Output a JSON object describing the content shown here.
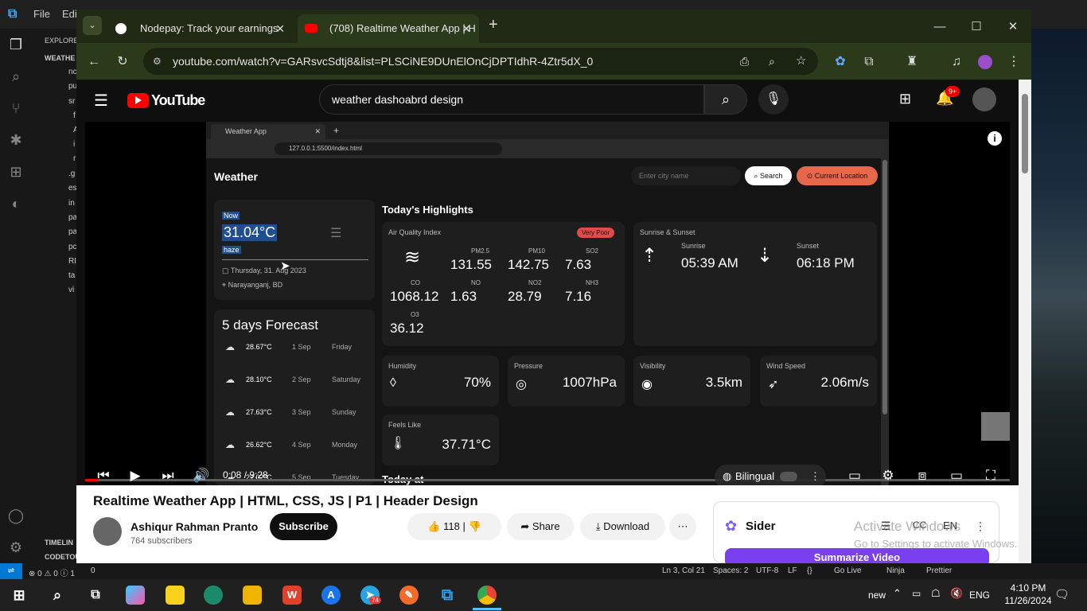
{
  "vscode": {
    "menu": [
      "File",
      "Edi"
    ],
    "explorer_label": "EXPLORE",
    "folder_label": "WEATHE",
    "tree": [
      "nc",
      "pu",
      "sr",
      "f",
      "A",
      "i",
      "r",
      ".g",
      "es",
      "in",
      "pa",
      "pa",
      "pc",
      "RI",
      "ta",
      "vi"
    ],
    "timeline_label": "TIMELIN",
    "codetour_label": "CODETOU",
    "status": {
      "left": "⊗ 0 ⚠ 0 ⓘ 1",
      "ports": "0",
      "position": "Ln 3, Col 21",
      "spaces": "Spaces: 2",
      "encoding": "UTF-8",
      "eol": "LF",
      "lang": "{}",
      "golive": "Go Live",
      "ninja": "Ninja",
      "prettier": "Prettier"
    }
  },
  "chrome": {
    "tabs": [
      {
        "title": "Nodepay: Track your earnings"
      },
      {
        "title": "(708) Realtime Weather App | H"
      }
    ],
    "url": "youtube.com/watch?v=GARsvcSdtj8&list=PLSCiNE9DUnElOnCjDPTIdhR-4Ztr5dX_0"
  },
  "youtube": {
    "logo": "YouTube",
    "search_value": "weather dashoabrd design",
    "notif_count": "9+",
    "video_title": "Realtime Weather App | HTML, CSS, JS | P1 | Header Design",
    "channel_name": "Ashiqur Rahman Pranto",
    "subscribers": "764 subscribers",
    "subscribe_label": "Subscribe",
    "like_count": "118",
    "share_label": "Share",
    "download_label": "Download",
    "time": "0:08 / 9:28",
    "progress_fraction": 0.014,
    "subtitle_label": "Bilingual",
    "sider": {
      "name": "Sider",
      "lang": "EN",
      "button": "Summarize Video"
    },
    "watermark": [
      "Activate Windows",
      "Go to Settings to activate Windows."
    ]
  },
  "video": {
    "tab": "Weather App",
    "url": "127.0.0.1:5500/index.html",
    "brand": "Weather",
    "search_placeholder": "Enter city name",
    "search_btn": "Search",
    "location_btn": "Current Location",
    "now_label": "Now",
    "temp": "31.04°C",
    "condition": "haze",
    "date": "Thursday, 31. Aug 2023",
    "place": "Narayanganj, BD",
    "highlights": "Today's Highlights",
    "aqi_title": "Air Quality Index",
    "aqi_badge": "Very Poor",
    "aqi": [
      {
        "label": "PM2.5",
        "value": "131.55"
      },
      {
        "label": "PM10",
        "value": "142.75"
      },
      {
        "label": "SO2",
        "value": "7.63"
      },
      {
        "label": "CO",
        "value": "1068.12"
      },
      {
        "label": "NO",
        "value": "1.63"
      },
      {
        "label": "NO2",
        "value": "28.79"
      },
      {
        "label": "NH3",
        "value": "7.16"
      },
      {
        "label": "O3",
        "value": "36.12"
      }
    ],
    "sun_title": "Sunrise & Sunset",
    "sunrise_label": "Sunrise",
    "sunrise": "05:39 AM",
    "sunset_label": "Sunset",
    "sunset": "06:18 PM",
    "humidity_label": "Humidity",
    "humidity": "70%",
    "pressure_label": "Pressure",
    "pressure": "1007hPa",
    "visibility_label": "Visibility",
    "visibility": "3.5km",
    "wind_label": "Wind Speed",
    "wind": "2.06m/s",
    "feels_label": "Feels Like",
    "feels": "37.71°C",
    "forecast_title": "5 days Forecast",
    "forecast": [
      {
        "temp": "28.67°C",
        "date": "1 Sep",
        "day": "Friday"
      },
      {
        "temp": "28.10°C",
        "date": "2 Sep",
        "day": "Saturday"
      },
      {
        "temp": "27.63°C",
        "date": "3 Sep",
        "day": "Sunday"
      },
      {
        "temp": "26.62°C",
        "date": "4 Sep",
        "day": "Monday"
      },
      {
        "temp": "27.02°C",
        "date": "5 Sep",
        "day": "Tuesday"
      }
    ],
    "today_at": "Today at"
  },
  "taskbar": {
    "tray_lang": "new",
    "eng": "ENG",
    "time": "4:10 PM",
    "date": "11/26/2024",
    "telegram_badge": "74"
  }
}
